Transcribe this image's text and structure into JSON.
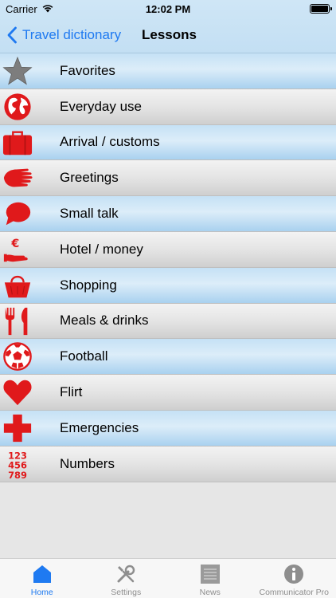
{
  "status": {
    "carrier": "Carrier",
    "time": "12:02 PM"
  },
  "nav": {
    "back_label": "Travel dictionary",
    "title": "Lessons"
  },
  "lessons": [
    {
      "label": "Favorites",
      "icon": "star-icon"
    },
    {
      "label": "Everyday use",
      "icon": "globe-icon"
    },
    {
      "label": "Arrival / customs",
      "icon": "suitcase-icon"
    },
    {
      "label": "Greetings",
      "icon": "hand-icon"
    },
    {
      "label": "Small talk",
      "icon": "speech-bubble-icon"
    },
    {
      "label": "Hotel / money",
      "icon": "euro-hand-icon"
    },
    {
      "label": "Shopping",
      "icon": "basket-icon"
    },
    {
      "label": "Meals & drinks",
      "icon": "fork-knife-icon"
    },
    {
      "label": "Football",
      "icon": "soccer-ball-icon"
    },
    {
      "label": "Flirt",
      "icon": "heart-icon"
    },
    {
      "label": "Emergencies",
      "icon": "red-cross-icon"
    },
    {
      "label": "Numbers",
      "icon": "numbers-icon"
    }
  ],
  "number_glyphs": [
    "123",
    "456",
    "789"
  ],
  "tabs": [
    {
      "label": "Home",
      "icon": "home-icon"
    },
    {
      "label": "Settings",
      "icon": "tools-icon"
    },
    {
      "label": "News",
      "icon": "news-icon"
    },
    {
      "label": "Communicator Pro",
      "icon": "info-icon"
    }
  ],
  "colors": {
    "accent": "#1f7af1",
    "icon_red": "#e0191b",
    "star_gray": "#7d7d7d"
  }
}
